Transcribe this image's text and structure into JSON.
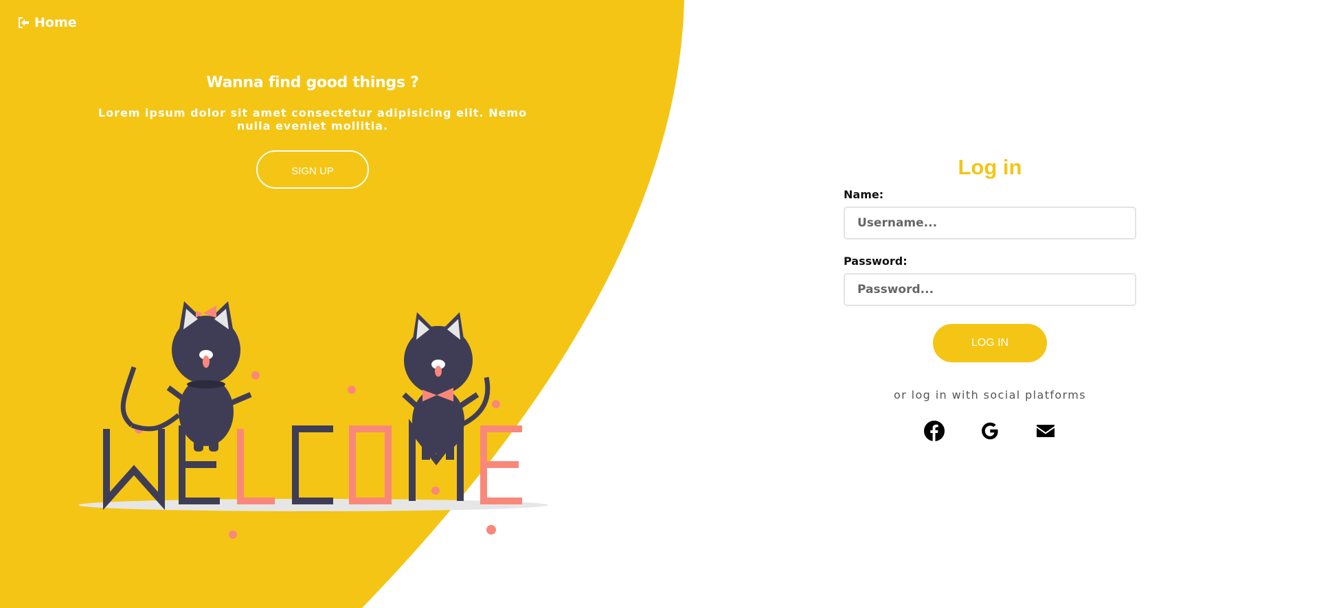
{
  "nav": {
    "home_label": "Home"
  },
  "left_panel": {
    "title": "Wanna find good things ?",
    "description": "Lorem ipsum dolor sit amet consectetur adipisicing elit. Nemo nulla eveniet mollitia.",
    "signup_label": "SIGN UP"
  },
  "illustration": {
    "letters": [
      "W",
      "E",
      "L",
      "C",
      "O",
      "M",
      "E"
    ]
  },
  "login": {
    "title": "Log in",
    "name_label": "Name:",
    "name_placeholder": "Username...",
    "password_label": "Password:",
    "password_placeholder": "Password...",
    "submit_label": "LOG IN",
    "social_text": "or log in with social platforms",
    "social_icons": [
      "facebook-icon",
      "google-icon",
      "envelope-icon"
    ]
  },
  "colors": {
    "accent": "#f4c514",
    "cat": "#3f3d56",
    "pink": "#f9887a",
    "white": "#ffffff"
  }
}
